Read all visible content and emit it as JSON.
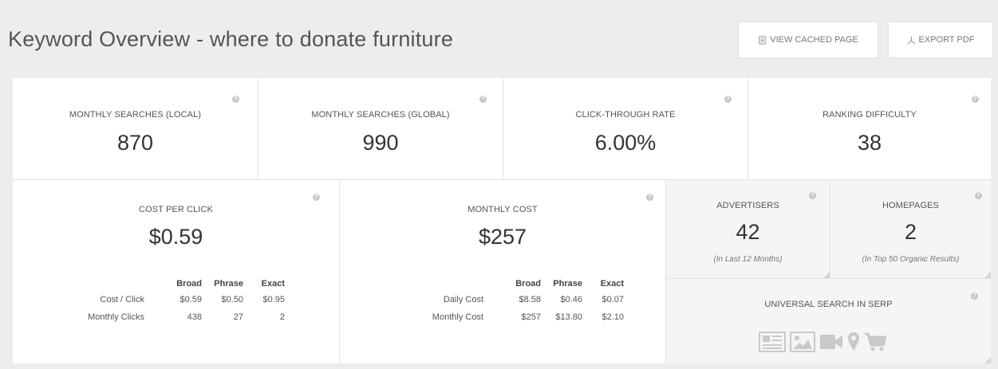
{
  "header": {
    "title": "Keyword Overview - where to donate furniture",
    "view_cached_label": "VIEW CACHED PAGE",
    "export_pdf_label": "EXPORT PDF"
  },
  "metrics": {
    "monthly_local": {
      "label": "MONTHLY SEARCHES (LOCAL)",
      "value": "870"
    },
    "monthly_global": {
      "label": "MONTHLY SEARCHES (GLOBAL)",
      "value": "990"
    },
    "ctr": {
      "label": "CLICK-THROUGH RATE",
      "value": "6.00%"
    },
    "difficulty": {
      "label": "RANKING DIFFICULTY",
      "value": "38"
    }
  },
  "cpc": {
    "label": "COST PER CLICK",
    "value": "$0.59",
    "headers": [
      "Broad",
      "Phrase",
      "Exact"
    ],
    "rows": [
      {
        "label": "Cost / Click",
        "values": [
          "$0.59",
          "$0.50",
          "$0.95"
        ]
      },
      {
        "label": "Monthly Clicks",
        "values": [
          "438",
          "27",
          "2"
        ]
      }
    ]
  },
  "monthly_cost": {
    "label": "MONTHLY COST",
    "value": "$257",
    "headers": [
      "Broad",
      "Phrase",
      "Exact"
    ],
    "rows": [
      {
        "label": "Daily Cost",
        "values": [
          "$8.58",
          "$0.46",
          "$0.07"
        ]
      },
      {
        "label": "Monthly Cost",
        "values": [
          "$257",
          "$13.80",
          "$2.10"
        ]
      }
    ]
  },
  "advertisers": {
    "label": "ADVERTISERS",
    "value": "42",
    "note": "(In Last 12 Months)"
  },
  "homepages": {
    "label": "HOMEPAGES",
    "value": "2",
    "note": "(In Top 50 Organic Results)"
  },
  "universal": {
    "label": "UNIVERSAL SEARCH IN SERP",
    "icons": [
      "news-icon",
      "image-icon",
      "video-icon",
      "map-pin-icon",
      "shopping-cart-icon"
    ]
  },
  "colors": {
    "icon_grey": "#c9c9c9",
    "help_grey": "#c8c8c8"
  }
}
